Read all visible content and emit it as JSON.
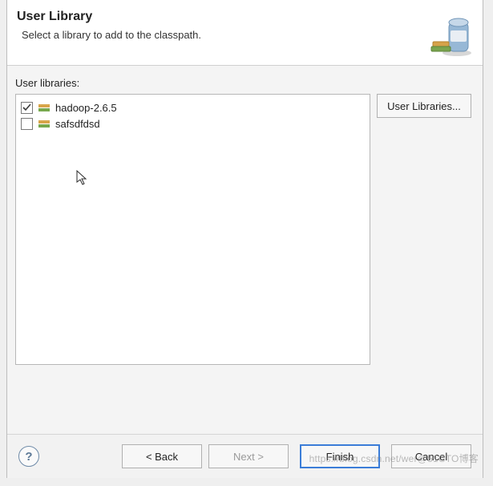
{
  "header": {
    "title": "User Library",
    "subtitle": "Select a library to add to the classpath."
  },
  "list_label": "User libraries:",
  "libraries": [
    {
      "name": "hadoop-2.6.5",
      "checked": true
    },
    {
      "name": "safsdfdsd",
      "checked": false
    }
  ],
  "buttons": {
    "user_libraries": "User Libraries...",
    "back": "< Back",
    "next": "Next >",
    "finish": "Finish",
    "cancel": "Cancel"
  },
  "watermark": "https://blog.csdn.net/wer@51CTO博客"
}
